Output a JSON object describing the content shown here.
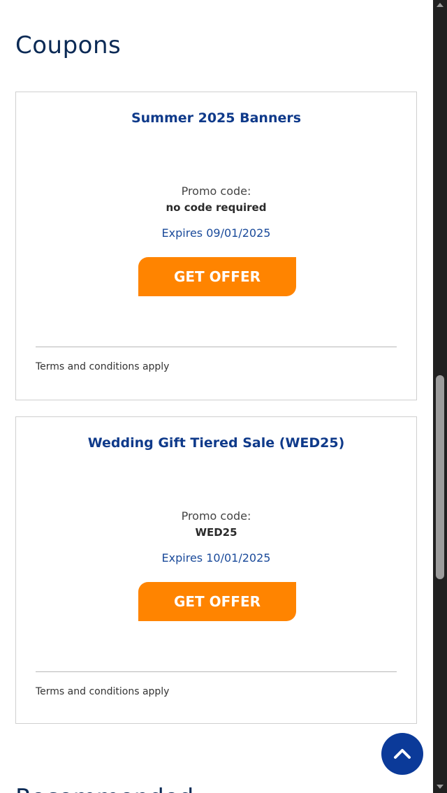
{
  "page": {
    "heading": "Coupons",
    "next_section_heading": "Recommended"
  },
  "coupons": [
    {
      "title": "Summer 2025 Banners",
      "promo_label": "Promo code:",
      "promo_value": "no code required",
      "expires": "Expires 09/01/2025",
      "button_label": "GET OFFER",
      "terms": "Terms and conditions apply"
    },
    {
      "title": "Wedding Gift Tiered Sale (WED25)",
      "promo_label": "Promo code:",
      "promo_value": "WED25",
      "expires": "Expires 10/01/2025",
      "button_label": "GET OFFER",
      "terms": "Terms and conditions apply"
    }
  ],
  "icons": {
    "back_to_top": "chevron-up-icon"
  },
  "colors": {
    "heading": "#0b2a55",
    "title": "#0f3a8a",
    "expires": "#1a4a9a",
    "button": "#ff8400",
    "back_to_top": "#0b3a99"
  }
}
